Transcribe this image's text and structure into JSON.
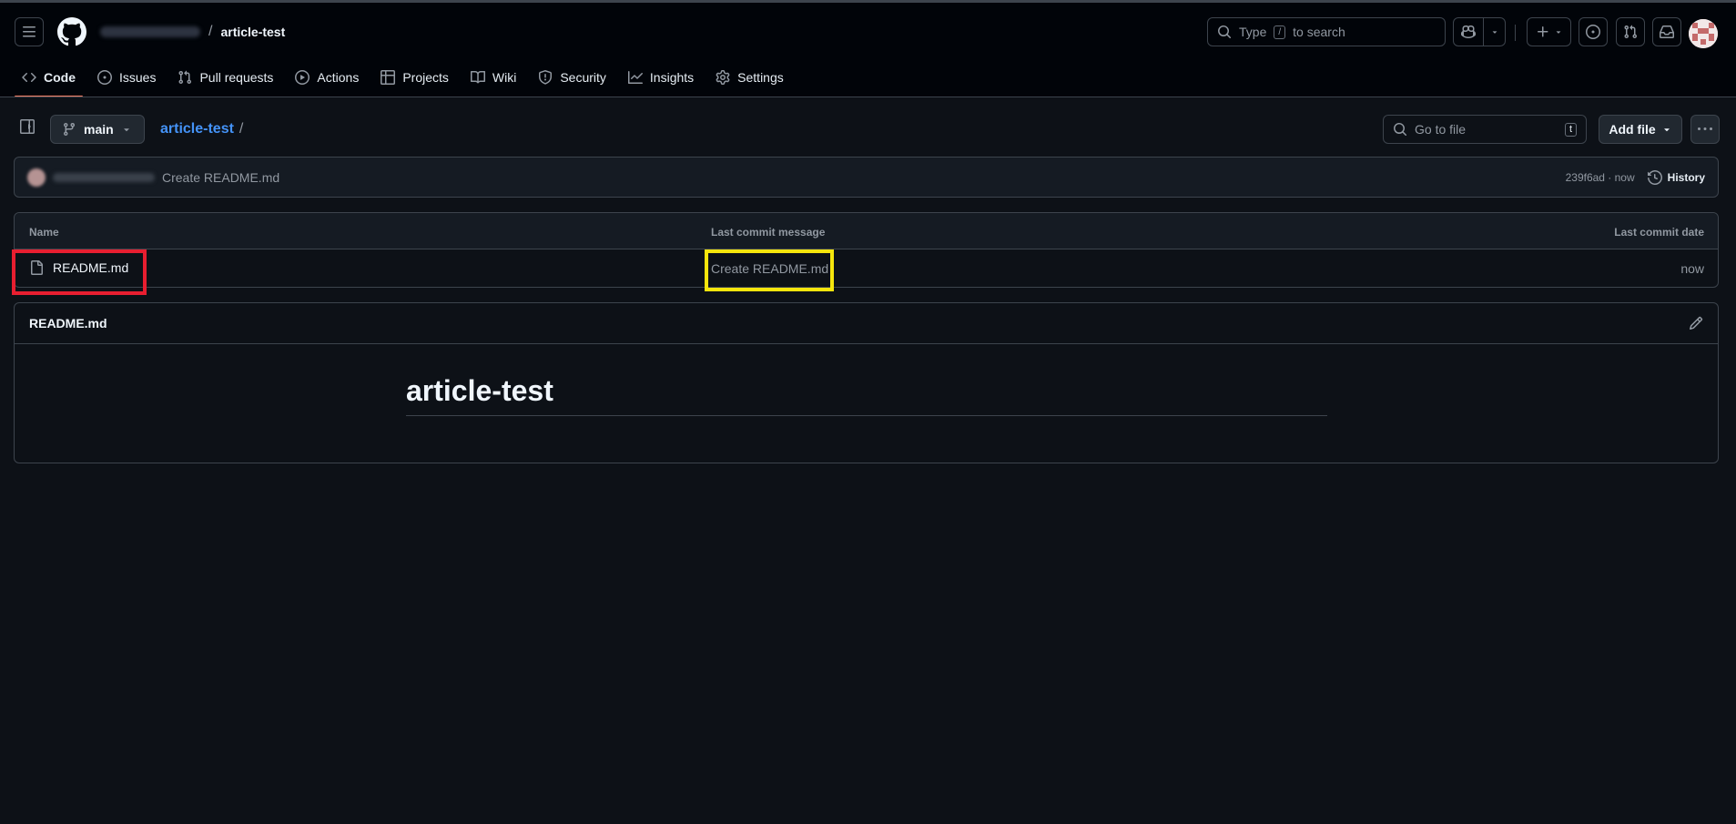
{
  "header": {
    "repo_name": "article-test",
    "separator": "/",
    "search_prefix": "Type",
    "search_key": "/",
    "search_suffix": "to search"
  },
  "tabs": [
    {
      "label": "Code",
      "icon": "code-icon",
      "active": true
    },
    {
      "label": "Issues",
      "icon": "issue-opened-icon"
    },
    {
      "label": "Pull requests",
      "icon": "git-pull-request-icon"
    },
    {
      "label": "Actions",
      "icon": "play-icon"
    },
    {
      "label": "Projects",
      "icon": "table-icon"
    },
    {
      "label": "Wiki",
      "icon": "book-icon"
    },
    {
      "label": "Security",
      "icon": "shield-icon"
    },
    {
      "label": "Insights",
      "icon": "graph-icon"
    },
    {
      "label": "Settings",
      "icon": "gear-icon"
    }
  ],
  "repobar": {
    "branch": "main",
    "breadcrumb_repo": "article-test",
    "breadcrumb_sep": "/",
    "goto_placeholder": "Go to file",
    "goto_key": "t",
    "add_file": "Add file"
  },
  "commit": {
    "message": "Create README.md",
    "sha_time": "239f6ad · now",
    "history": "History"
  },
  "file_table": {
    "columns": [
      "Name",
      "Last commit message",
      "Last commit date"
    ],
    "rows": [
      {
        "name": "README.md",
        "message": "Create README.md",
        "date": "now"
      }
    ]
  },
  "readme": {
    "filename": "README.md",
    "heading": "article-test"
  },
  "colors": {
    "accent_link": "#4493f8",
    "active_tab_underline": "#f78166",
    "highlight_red": "#e81e30",
    "highlight_yellow": "#f5e50c"
  }
}
